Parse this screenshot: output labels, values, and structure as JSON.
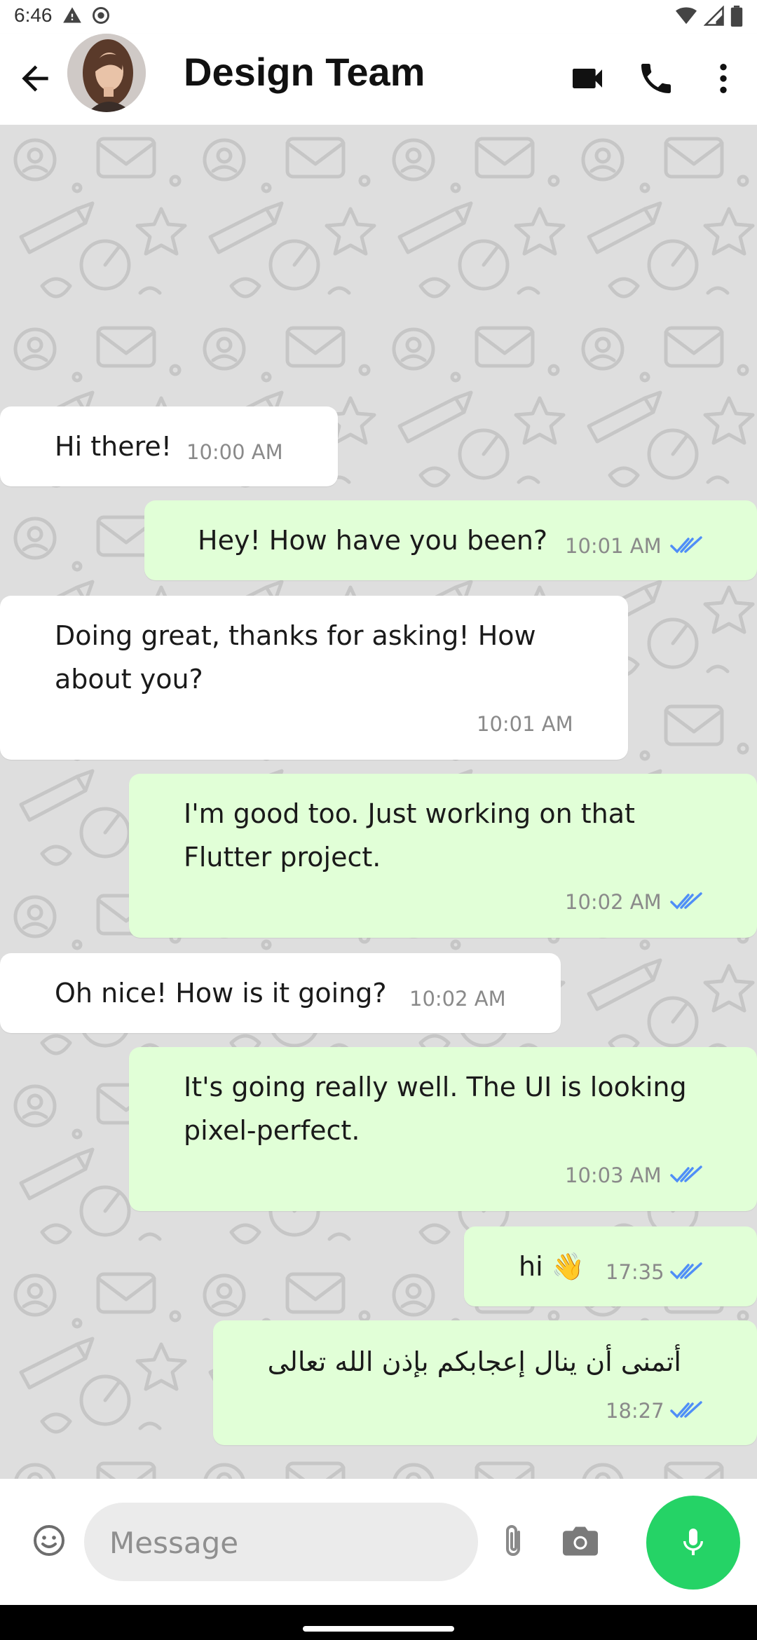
{
  "status_bar": {
    "time": "6:46",
    "icons": [
      "alert-icon",
      "sync-icon",
      "wifi-icon",
      "signal-icon",
      "battery-icon"
    ]
  },
  "header": {
    "title": "Design Team",
    "back_icon": "arrow-back-icon",
    "video_icon": "videocam-icon",
    "call_icon": "phone-icon",
    "more_icon": "more-vert-icon"
  },
  "messages": [
    {
      "direction": "in",
      "text": "Hi there!",
      "time": "10:00 AM"
    },
    {
      "direction": "out",
      "text": "Hey! How have you been?",
      "time": "10:01 AM",
      "read": true
    },
    {
      "direction": "in",
      "text_lines": [
        "Doing great, thanks for asking! How",
        "about you?"
      ],
      "time": "10:01 AM"
    },
    {
      "direction": "out",
      "text_lines": [
        "I'm good too. Just working on that",
        "Flutter project."
      ],
      "time": "10:02 AM",
      "read": true
    },
    {
      "direction": "in",
      "text": "Oh nice! How is it going?",
      "time": "10:02 AM"
    },
    {
      "direction": "out",
      "text_lines": [
        "It's going really well. The UI is looking",
        "pixel-perfect."
      ],
      "time": "10:03 AM",
      "read": true
    },
    {
      "direction": "out",
      "text": "hi 👋",
      "time": "17:35",
      "read": true
    },
    {
      "direction": "out",
      "text": "أتمنى أن ينال إعجابكم بإذن الله تعالى",
      "time": "18:27",
      "read": true
    }
  ],
  "composer": {
    "placeholder": "Message",
    "emoji_icon": "emoji-icon",
    "attach_icon": "attach-icon",
    "camera_icon": "camera-icon",
    "mic_icon": "mic-icon"
  },
  "colors": {
    "incoming_bubble": "#ffffff",
    "outgoing_bubble": "#e1ffd7",
    "chat_background": "#dedede",
    "read_ticks": "#4f8ef7",
    "mic_button": "#25d366"
  }
}
